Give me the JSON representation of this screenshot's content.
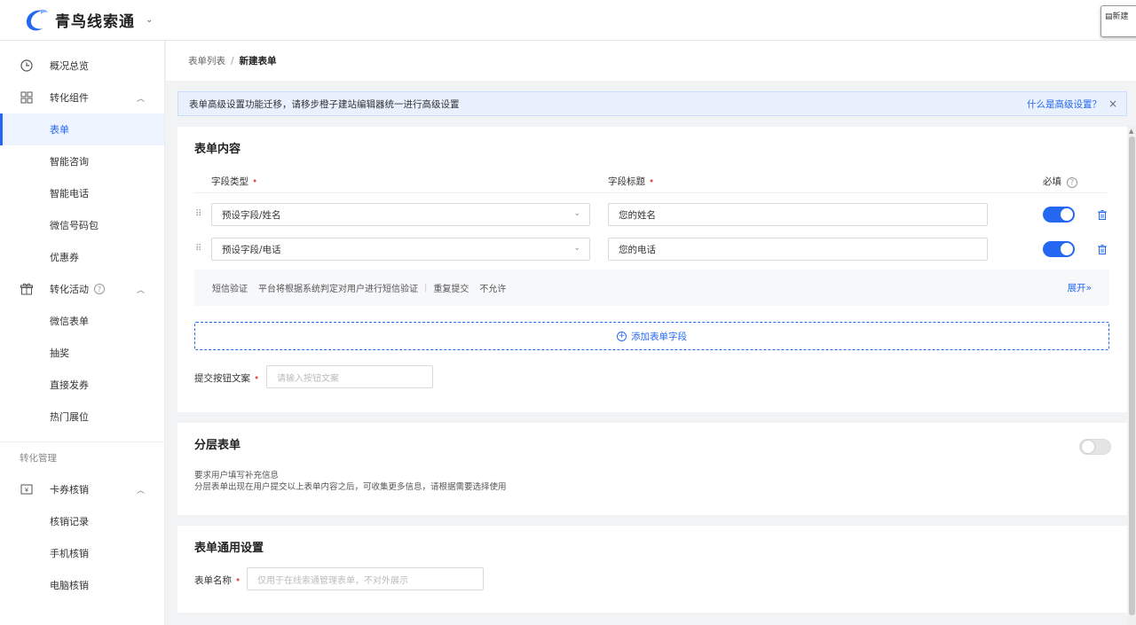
{
  "app": {
    "brand": "青鸟线索通"
  },
  "new_popup": {
    "label": "新建"
  },
  "sidebar": {
    "overview": "概况总览",
    "conversion_components": "转化组件",
    "components": [
      "表单",
      "智能咨询",
      "智能电话",
      "微信号码包",
      "优惠券"
    ],
    "conversion_activities": "转化活动",
    "activities": [
      "微信表单",
      "抽奖",
      "直接发券",
      "热门展位"
    ],
    "section_management": "转化管理",
    "card_verify": "卡券核销",
    "verify_items": [
      "核销记录",
      "手机核销",
      "电脑核销"
    ]
  },
  "breadcrumb": {
    "parent": "表单列表",
    "sep": "/",
    "current": "新建表单"
  },
  "notice": {
    "text": "表单高级设置功能迁移，请移步橙子建站编辑器统一进行高级设置",
    "link": "什么是高级设置？",
    "close": "×"
  },
  "form_content": {
    "title": "表单内容",
    "col_field_type": "字段类型",
    "col_field_title": "字段标题",
    "col_required": "必填",
    "rows": [
      {
        "type": "预设字段/姓名",
        "title": "您的姓名",
        "required": true
      },
      {
        "type": "预设字段/电话",
        "title": "您的电话",
        "required": true
      }
    ],
    "sms": {
      "label": "短信验证",
      "value": "平台将根据系统判定对用户进行短信验证",
      "repeat_label": "重复提交",
      "repeat_value": "不允许",
      "expand": "展开"
    },
    "add_field": "添加表单字段",
    "submit_label": "提交按钮文案",
    "submit_placeholder": "请输入按钮文案"
  },
  "layered": {
    "title": "分层表单",
    "enabled": false,
    "desc1": "要求用户填写补充信息",
    "desc2": "分层表单出现在用户提交以上表单内容之后，可收集更多信息，请根据需要选择使用"
  },
  "general": {
    "title": "表单通用设置",
    "name_label": "表单名称",
    "name_placeholder": "仅用于在线索通管理表单，不对外展示"
  },
  "colors": {
    "accent": "#2468f2",
    "required": "#e34d59"
  }
}
